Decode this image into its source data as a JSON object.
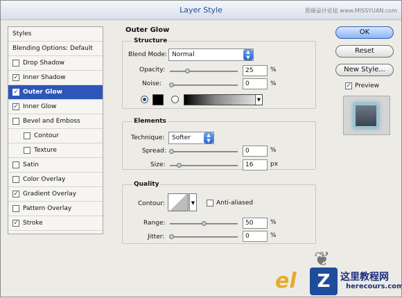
{
  "window": {
    "title": "Layer Style",
    "watermark": "思缘设计论坛 www.MISSYUAN.com"
  },
  "styles_panel": {
    "header": "Styles",
    "blending": "Blending Options: Default",
    "items": [
      {
        "label": "Drop Shadow",
        "checked": false
      },
      {
        "label": "Inner Shadow",
        "checked": true
      },
      {
        "label": "Outer Glow",
        "checked": true
      },
      {
        "label": "Inner Glow",
        "checked": true
      },
      {
        "label": "Bevel and Emboss",
        "checked": false
      },
      {
        "label": "Contour",
        "checked": false
      },
      {
        "label": "Texture",
        "checked": false
      },
      {
        "label": "Satin",
        "checked": false
      },
      {
        "label": "Color Overlay",
        "checked": false
      },
      {
        "label": "Gradient Overlay",
        "checked": true
      },
      {
        "label": "Pattern Overlay",
        "checked": false
      },
      {
        "label": "Stroke",
        "checked": true
      }
    ]
  },
  "outer_glow": {
    "title": "Outer Glow",
    "structure": {
      "title": "Structure",
      "blend_mode_label": "Blend Mode:",
      "blend_mode_value": "Normal",
      "opacity_label": "Opacity:",
      "opacity_value": "25",
      "opacity_unit": "%",
      "noise_label": "Noise:",
      "noise_value": "0",
      "noise_unit": "%",
      "color_mode": "solid"
    },
    "elements": {
      "title": "Elements",
      "technique_label": "Technique:",
      "technique_value": "Softer",
      "spread_label": "Spread:",
      "spread_value": "0",
      "spread_unit": "%",
      "size_label": "Size:",
      "size_value": "16",
      "size_unit": "px"
    },
    "quality": {
      "title": "Quality",
      "contour_label": "Contour:",
      "anti_aliased_label": "Anti-aliased",
      "anti_aliased_checked": false,
      "range_label": "Range:",
      "range_value": "50",
      "range_unit": "%",
      "jitter_label": "Jitter:",
      "jitter_value": "0",
      "jitter_unit": "%"
    }
  },
  "buttons": {
    "ok": "OK",
    "reset": "Reset",
    "new_style": "New Style...",
    "preview": "Preview"
  },
  "logo": {
    "cn": "这里教程网",
    "en": "herecours.com"
  },
  "colors": {
    "accent": "#2d56b8",
    "glow_color": "#000000"
  }
}
